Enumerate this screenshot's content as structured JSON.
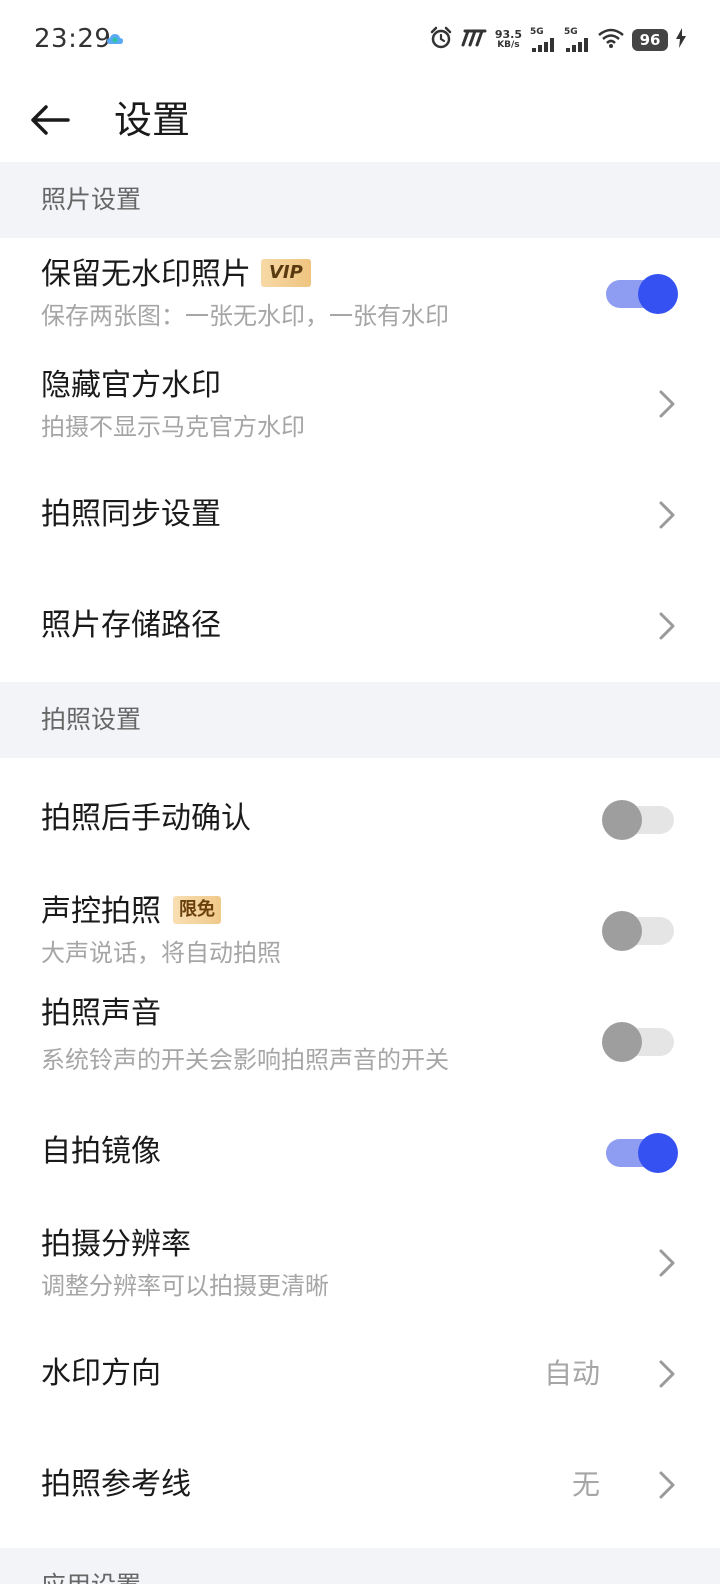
{
  "status_bar": {
    "time": "23:29",
    "net_speed_value": "93.5",
    "net_speed_unit": "KB/s",
    "sim1_label": "5G",
    "sim2_label": "5G",
    "battery": "96"
  },
  "header": {
    "title": "设置"
  },
  "sections": {
    "photo": {
      "title": "照片设置",
      "items": [
        {
          "title": "保留无水印照片",
          "badge": "VIP",
          "subtitle": "保存两张图：一张无水印，一张有水印",
          "toggle": true
        },
        {
          "title": "隐藏官方水印",
          "subtitle": "拍摄不显示马克官方水印"
        },
        {
          "title": "拍照同步设置"
        },
        {
          "title": "照片存储路径"
        }
      ]
    },
    "capture": {
      "title": "拍照设置",
      "items": [
        {
          "title": "拍照后手动确认",
          "toggle": false
        },
        {
          "title": "声控拍照",
          "badge": "限免",
          "subtitle": "大声说话，将自动拍照",
          "toggle": false
        },
        {
          "title": "拍照声音",
          "subtitle": "系统铃声的开关会影响拍照声音的开关",
          "toggle": false
        },
        {
          "title": "自拍镜像",
          "toggle": true
        },
        {
          "title": "拍摄分辨率",
          "subtitle": "调整分辨率可以拍摄更清晰"
        },
        {
          "title": "水印方向",
          "value": "自动"
        },
        {
          "title": "拍照参考线",
          "value": "无"
        }
      ]
    },
    "app": {
      "title": "应用设置"
    }
  },
  "colors": {
    "accent": "#3651f2",
    "accent_track": "#8e9df2",
    "section_bg": "#f2f4f8"
  }
}
